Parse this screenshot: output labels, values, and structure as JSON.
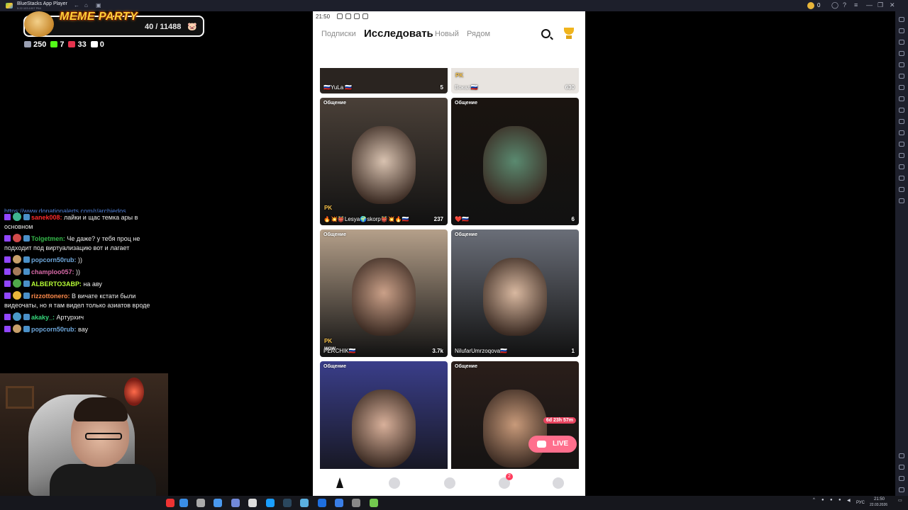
{
  "emulator": {
    "title": "BlueStacks App Player",
    "subtitle": "5.22.103.1007 P64",
    "coins": "0",
    "icons": [
      "back-icon",
      "home-icon",
      "multi-instance-icon",
      "coin-icon",
      "account-icon",
      "help-icon",
      "menu-icon",
      "minimize-icon",
      "restore-icon",
      "close-icon"
    ]
  },
  "widget": {
    "title": "MEME PARTY",
    "count": "40 / 11488",
    "icon": "pig-icon"
  },
  "stats": [
    {
      "icon": "chat-icon",
      "value": "250",
      "color": "#9aa0b3"
    },
    {
      "icon": "kick-icon",
      "value": "7",
      "color": "#53fc18"
    },
    {
      "icon": "vk-icon",
      "value": "33",
      "color": "#e5334d"
    },
    {
      "icon": "w-icon",
      "value": "0",
      "color": "#ffffff"
    }
  ],
  "chat": {
    "link": "https://www.donationalerts.com/r/archiedos",
    "messages": [
      {
        "user": "sanek008:",
        "text": " лайки и щас темка ары в основном",
        "color": "#ff2a2a",
        "avatar": "#3fb58f"
      },
      {
        "user": "Tolgetmen:",
        "text": " Че даже? у тебя проц не подходит под виртуализацию вот и лагает",
        "color": "#35b84a",
        "avatar": "#d04a4a"
      },
      {
        "user": "popcorn50rub:",
        "text": " ))",
        "color": "#6fa8dc",
        "avatar": "#c8a06a"
      },
      {
        "user": "champloo057:",
        "text": " ))",
        "color": "#d86aa8",
        "avatar": "#a57a5a"
      },
      {
        "user": "ALBERTOЗАВР:",
        "text": " на аву",
        "color": "#b8ff36",
        "avatar": "#4fa84a"
      },
      {
        "user": "rizzottonero:",
        "text": " В вичате кстати были видеочаты, но я там видел только азиатов вроде",
        "color": "#ff8a4a",
        "avatar": "#e8b53a"
      },
      {
        "user": "akaky_:",
        "text": " Артурхич",
        "color": "#35d67a",
        "avatar": "#4a9ac8"
      },
      {
        "user": "popcorn50rub:",
        "text": " вау",
        "color": "#6fa8dc",
        "avatar": "#c8a06a"
      }
    ]
  },
  "app": {
    "status_time": "21:50",
    "tabs": {
      "following": "Подписки",
      "explore": "Исследовать",
      "new": "Новый",
      "nearby": "Рядом"
    },
    "icons": {
      "search": "search-icon",
      "trophy": "trophy-icon",
      "expand": "chevron-down-icon"
    },
    "flag_groups": [
      {
        "flags": [
          "#1c7a3e",
          "#0a7a3a",
          "#c8102e",
          "#e30a17"
        ]
      },
      {
        "flags": [
          "#ce1126",
          "#c8102e"
        ]
      },
      {
        "flags": [
          "#da251d",
          "#cd2e3a",
          "#fecb00"
        ]
      },
      {
        "flags": [
          "#009c3b",
          "#006600",
          "#fcd116"
        ]
      }
    ],
    "top_cards": [
      {
        "name": "🇷🇺YuLa 🇷🇺",
        "viewers": "5"
      },
      {
        "name": "Вокал🇷🇺",
        "viewers": "630",
        "pk": "PK"
      }
    ],
    "cards": [
      {
        "tag": "Общение",
        "name": "🔥💥👹Lesya🌍skorp👹💥🔥🇷🇺",
        "viewers": "237",
        "pk": "PK",
        "bg": "#4a4038",
        "face": "#d8c2b0"
      },
      {
        "tag": "Общение",
        "name": "❤️🇷🇺",
        "viewers": "6",
        "bg": "#1a1410",
        "face": "#5a8a70"
      },
      {
        "tag": "Общение",
        "name": "PERCHIK🇷🇺",
        "viewers": "3.7k",
        "pk": "PK",
        "wow": "WOW",
        "bg": "#b5a08a",
        "face": "#caa088"
      },
      {
        "tag": "Общение",
        "name": "NilufarUmrzoqova🇷🇺",
        "viewers": "1",
        "bg": "#6a6e78",
        "face": "#d8b8a0"
      },
      {
        "tag": "Общение",
        "name": "",
        "viewers": "",
        "bg": "#3a3e8a",
        "face": "#d8b09a"
      },
      {
        "tag": "Общение",
        "name": "",
        "viewers": "",
        "bg": "#2a1e1a",
        "face": "#c89a7a",
        "timer": "6d 23h 57m",
        "live": "LIVE"
      }
    ],
    "bottom_tabs": [
      "explore-tab-icon",
      "party-tab-icon",
      "planet-tab-icon",
      "messages-tab-icon",
      "profile-tab-icon"
    ],
    "messages_badge": "2"
  },
  "taskbar": {
    "lang": "РУС",
    "time": "21:50",
    "date": "22.03.2026"
  }
}
